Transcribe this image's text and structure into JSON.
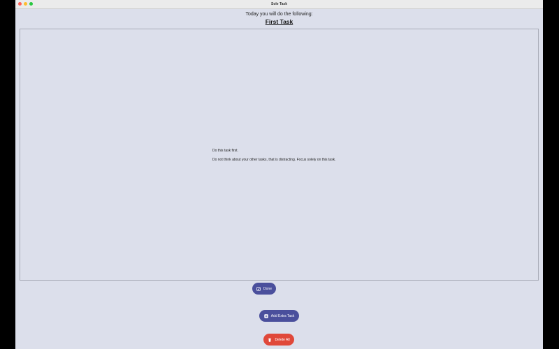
{
  "window": {
    "title": "Sole Task"
  },
  "header": {
    "prompt": "Today you will do the following:",
    "task_title": "First Task"
  },
  "task": {
    "description_line1": "Do this task first.",
    "description_line2": "Do not think about your other tasks, that is distracting. Focus solely on this task."
  },
  "buttons": {
    "done_label": "Done",
    "done_icon": "checkbox-icon",
    "add_label": "Add Extra Task",
    "add_icon": "plus-square-icon",
    "delete_label": "Delete All",
    "delete_icon": "trash-icon"
  },
  "colors": {
    "background": "#dcdfeb",
    "primary_button": "#4a4f9c",
    "danger_button": "#e0483a"
  }
}
